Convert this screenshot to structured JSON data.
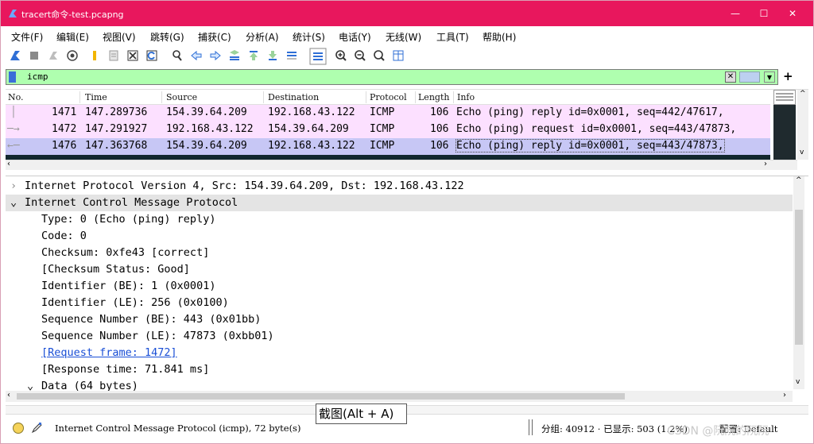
{
  "window": {
    "title": "tracert命令-test.pcapng",
    "controls": {
      "minimize": "—",
      "maximize": "☐",
      "close": "✕"
    }
  },
  "menubar": {
    "items": [
      {
        "label": "文件(F)"
      },
      {
        "label": "编辑(E)"
      },
      {
        "label": "视图(V)"
      },
      {
        "label": "跳转(G)"
      },
      {
        "label": "捕获(C)"
      },
      {
        "label": "分析(A)"
      },
      {
        "label": "统计(S)"
      },
      {
        "label": "电话(Y)"
      },
      {
        "label": "无线(W)"
      },
      {
        "label": "工具(T)"
      },
      {
        "label": "帮助(H)"
      }
    ]
  },
  "filter": {
    "value": "icmp",
    "background": "#afffaf"
  },
  "packet_list": {
    "columns": [
      "No.",
      "Time",
      "Source",
      "Destination",
      "Protocol",
      "Length",
      "Info"
    ],
    "rows": [
      {
        "no": "1471",
        "time": "147.289736",
        "src": "154.39.64.209",
        "dst": "192.168.43.122",
        "proto": "ICMP",
        "len": "106",
        "info": "Echo (ping) reply    id=0x0001, seq=442/47617,"
      },
      {
        "no": "1472",
        "time": "147.291927",
        "src": "192.168.43.122",
        "dst": "154.39.64.209",
        "proto": "ICMP",
        "len": "106",
        "info": "Echo (ping) request  id=0x0001, seq=443/47873,"
      },
      {
        "no": "1476",
        "time": "147.363768",
        "src": "154.39.64.209",
        "dst": "192.168.43.122",
        "proto": "ICMP",
        "len": "106",
        "info": "Echo (ping) reply    id=0x0001, seq=443/47873,"
      }
    ],
    "row_colors": [
      "#fce0ff",
      "#fce0ff",
      "#c7c7f5"
    ]
  },
  "details": {
    "lines": [
      "Internet Protocol Version 4, Src: 154.39.64.209, Dst: 192.168.43.122",
      "Internet Control Message Protocol",
      "Type: 0 (Echo (ping) reply)",
      "Code: 0",
      "Checksum: 0xfe43 [correct]",
      "[Checksum Status: Good]",
      "Identifier (BE): 1 (0x0001)",
      "Identifier (LE): 256 (0x0100)",
      "Sequence Number (BE): 443 (0x01bb)",
      "Sequence Number (LE): 47873 (0xbb01)",
      "[Request frame: 1472]",
      "[Response time: 71.841 ms]",
      "Data (64 bytes)"
    ],
    "expander_collapsed": "›",
    "expander_expanded": "⌄"
  },
  "status": {
    "protocol_text": "Internet Control Message Protocol (icmp), 72 byte(s)",
    "packets_text": "分组: 40912 · 已显示: 503 (1.2%)",
    "profile_text": "配置: Default"
  },
  "tooltip": {
    "text": "截图(Alt + A)"
  },
  "watermark": {
    "text": "CSDN @阮阮的阮阮"
  },
  "colors": {
    "titlebar": "#e8175d",
    "selected_row": "#c7c7f5",
    "ping_row": "#fce0ff"
  }
}
